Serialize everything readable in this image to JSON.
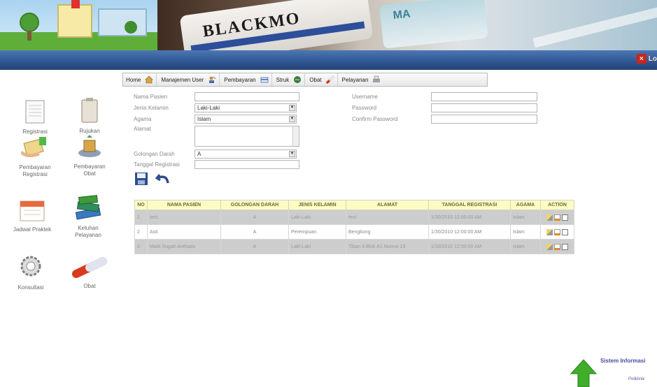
{
  "header": {
    "logout_label": "Lo"
  },
  "menu": [
    {
      "label": "Home",
      "icon": "home-icon"
    },
    {
      "label": "Manajemen User",
      "icon": "user-management-icon"
    },
    {
      "label": "Pembayaran",
      "icon": "payment-icon"
    },
    {
      "label": "Struk",
      "icon": "receipt-icon"
    },
    {
      "label": "Obat",
      "icon": "pill-icon"
    },
    {
      "label": "Pelayanan",
      "icon": "service-icon"
    }
  ],
  "launcher": [
    {
      "label": "Registrasi",
      "icon": "document-icon"
    },
    {
      "label": "Rujukan",
      "icon": "clipboard-icon"
    },
    {
      "label": "Pembayaran Registrasi",
      "icon": "payment-icon"
    },
    {
      "label": "Pembayaran Obat",
      "icon": "medicine-payment-icon"
    },
    {
      "label": "Jadwal Praktek",
      "icon": "calendar-icon"
    },
    {
      "label": "Keluhan Pelayanan",
      "icon": "books-icon"
    },
    {
      "label": "Konsultasi",
      "icon": "gears-icon"
    },
    {
      "label": "Obat",
      "icon": "capsule-icon"
    }
  ],
  "form": {
    "nama_pasien_label": "Nama Pasien",
    "nama_pasien_value": "",
    "jenis_kelamin_label": "Jenis Kelamin",
    "jenis_kelamin_value": "Laki-Laki",
    "agama_label": "Agama",
    "agama_value": "Islam",
    "alamat_label": "Alamat",
    "alamat_value": "",
    "golongan_darah_label": "Golongan Darah",
    "golongan_darah_value": "A",
    "tanggal_registrasi_label": "Tanggal Registrasi",
    "tanggal_registrasi_value": "",
    "username_label": "Username",
    "username_value": "",
    "password_label": "Password",
    "password_value": "",
    "confirm_password_label": "Confirm Password",
    "confirm_password_value": ""
  },
  "table": {
    "headers": [
      "NO",
      "NAMA PASIEN",
      "GOLONGAN DARAH",
      "JENIS KELAMIN",
      "ALAMAT",
      "TANGGAL REGISTRASI",
      "AGAMA",
      "ACTION"
    ],
    "rows": [
      {
        "no": "1",
        "nama": "test",
        "gol": "A",
        "jk": "Laki-Laki",
        "alamat": "test",
        "tanggal": "1/30/2010 12:00:00 AM",
        "agama": "Islam"
      },
      {
        "no": "2",
        "nama": "Asti",
        "gol": "A",
        "jk": "Perempuan",
        "alamat": "Bengkong",
        "tanggal": "1/30/2010 12:00:00 AM",
        "agama": "Islam"
      },
      {
        "no": "3",
        "nama": "Mark Sugah Anthadu",
        "gol": "A",
        "jk": "Laki-Laki",
        "alamat": "Tiban 4 Blok A1 Nomor 19",
        "tanggal": "1/30/2010 12:00:00 AM",
        "agama": "Islam"
      }
    ]
  },
  "footer": {
    "title": "Sistem Informasi",
    "subtitle": "Poliklinik"
  },
  "colors": {
    "header_blue": "#2f5591",
    "table_header": "#fbfbc4",
    "alt_row": "#cdcdcd",
    "footer_arrow": "#3fae2a"
  }
}
